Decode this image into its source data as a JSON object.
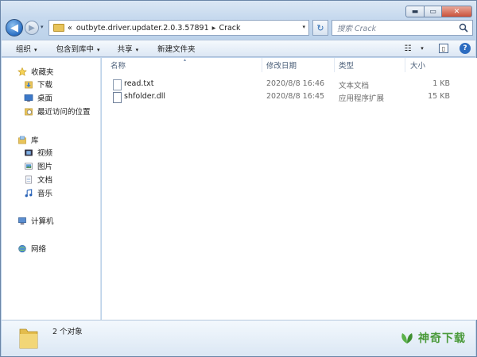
{
  "window": {
    "caption_min": "▬",
    "caption_max": "▭",
    "caption_close": "✕"
  },
  "nav": {
    "back_glyph": "◀",
    "forward_glyph": "▶",
    "history_glyph": "▾",
    "address_prefix": "«",
    "address_segments": [
      "outbyte.driver.updater.2.0.3.57891",
      "Crack"
    ],
    "address_sep": "▸",
    "address_drop": "▾",
    "refresh_glyph": "↻",
    "search_placeholder": "搜索 Crack"
  },
  "toolbar": {
    "organize": "组织",
    "include_in_library": "包含到库中",
    "share": "共享",
    "new_folder": "新建文件夹",
    "arrow": "▾",
    "view_glyph": "☷",
    "view_drop": "▾",
    "preview_glyph": "▯",
    "help_glyph": "?"
  },
  "sidebar": {
    "favorites": "收藏夹",
    "downloads": "下载",
    "desktop": "桌面",
    "recent": "最近访问的位置",
    "libraries": "库",
    "videos": "视频",
    "pictures": "图片",
    "documents": "文档",
    "music": "音乐",
    "computer": "计算机",
    "network": "网络"
  },
  "columns": {
    "name": "名称",
    "date": "修改日期",
    "type": "类型",
    "size": "大小",
    "sort_glyph": "▴"
  },
  "files": [
    {
      "name": "read.txt",
      "date": "2020/8/8 16:46",
      "type": "文本文档",
      "size": "1 KB",
      "icon": "text-file-icon"
    },
    {
      "name": "shfolder.dll",
      "date": "2020/8/8 16:45",
      "type": "应用程序扩展",
      "size": "15 KB",
      "icon": "dll-file-icon"
    }
  ],
  "status": {
    "count": "2 个对象"
  },
  "watermark": {
    "text": "神奇下载"
  },
  "colors": {
    "accent": "#2d6cc0",
    "folder": "#e8c45b",
    "watermark": "#4a9a3a"
  }
}
